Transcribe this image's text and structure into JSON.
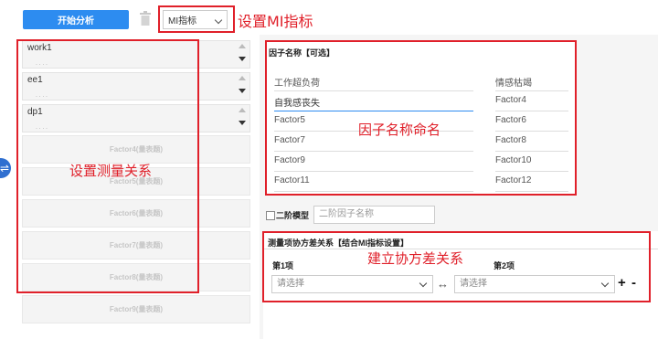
{
  "toolbar": {
    "start_label": "开始分析",
    "mi_select_value": "MI指标",
    "trash_icon": "trash-icon"
  },
  "annotations": {
    "mi": "设置MI指标",
    "measure": "设置测量关系",
    "naming": "因子名称命名",
    "covariance": "建立协方差关系"
  },
  "left": {
    "relations": [
      {
        "label": "work1",
        "dots": "· · · ·"
      },
      {
        "label": "ee1",
        "dots": "· · · ·"
      },
      {
        "label": "dp1",
        "dots": "· · · ·"
      }
    ],
    "factor_slots": [
      "Factor4(量表题)",
      "Factor5(量表题)",
      "Factor6(量表题)",
      "Factor7(量表题)",
      "Factor8(量表题)",
      "Factor9(量表题)"
    ]
  },
  "factor_names": {
    "title": "因子名称【可选】",
    "left_col": [
      "工作超负荷",
      "自我感丧失",
      "Factor5",
      "Factor7",
      "Factor9",
      "Factor11"
    ],
    "right_col": [
      "情感枯竭",
      "Factor4",
      "Factor6",
      "Factor8",
      "Factor10",
      "Factor12"
    ]
  },
  "second_order": {
    "checkbox_label": "二阶模型",
    "name_placeholder": "二阶因子名称"
  },
  "covariance": {
    "title": "测量项协方差关系【结合MI指标设置】",
    "item1_label": "第1项",
    "item2_label": "第2项",
    "select1_placeholder": "请选择",
    "select2_placeholder": "请选择",
    "swap_symbol": "↔",
    "plus": "+",
    "minus": "-"
  },
  "colors": {
    "accent": "#2d8cf0",
    "annotation_red": "#e0202a"
  }
}
